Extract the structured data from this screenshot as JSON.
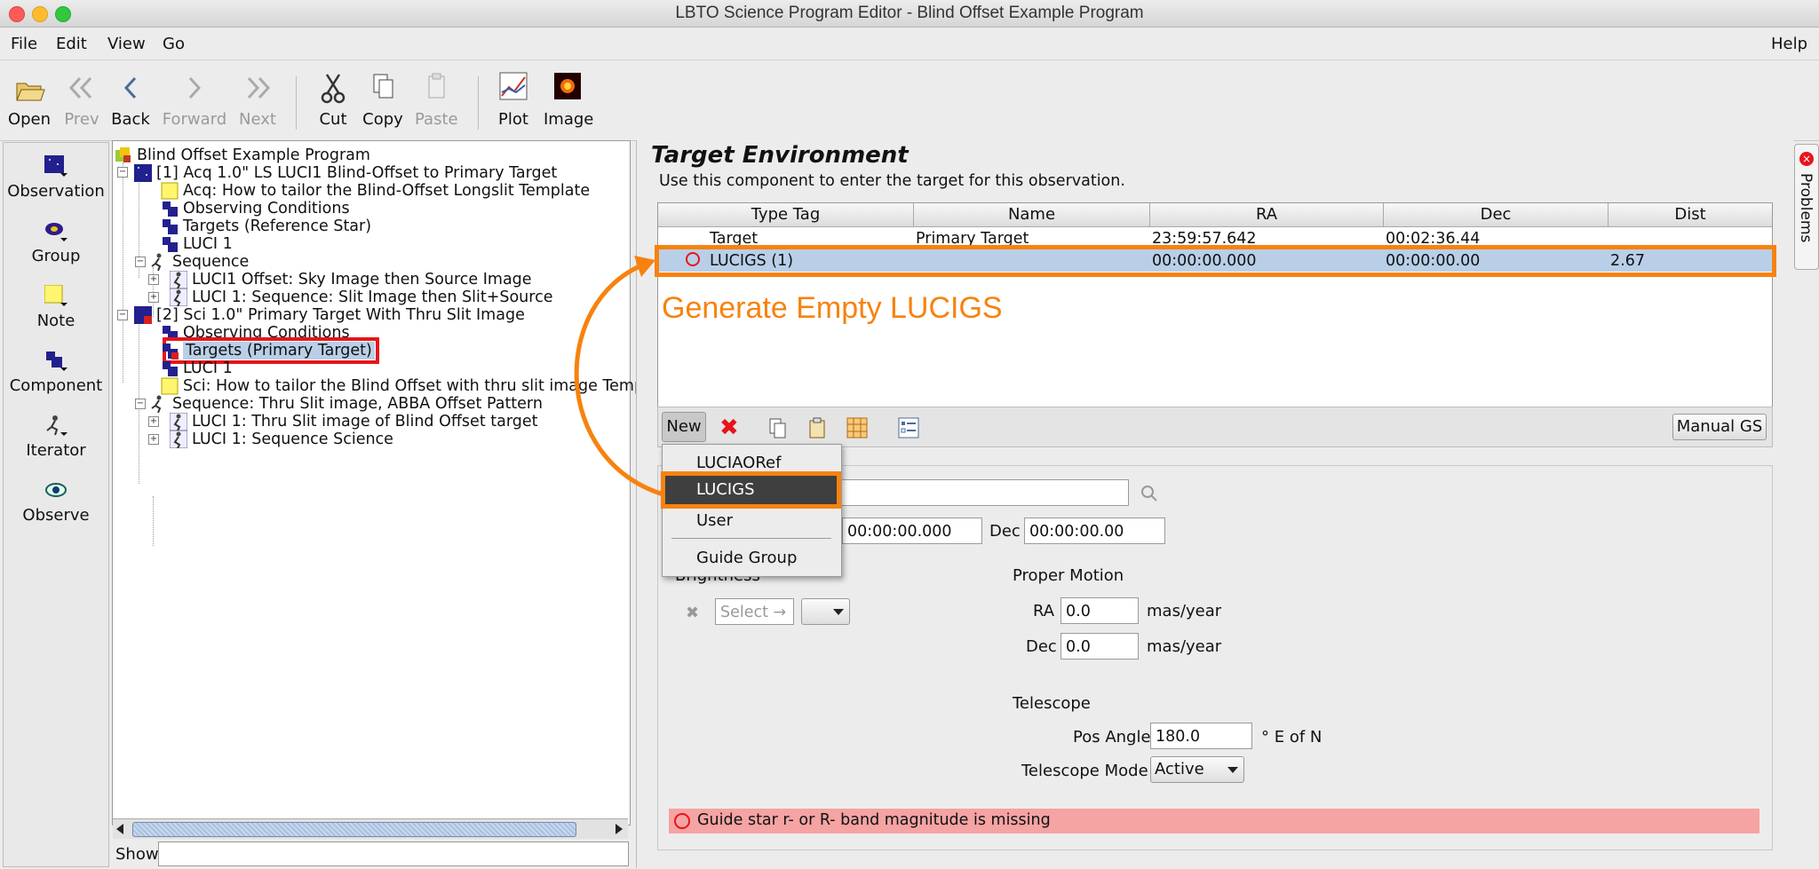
{
  "window": {
    "title": "LBTO Science Program Editor - Blind Offset Example Program"
  },
  "menu": {
    "file": "File",
    "edit": "Edit",
    "view": "View",
    "go": "Go",
    "help": "Help"
  },
  "toolbar": {
    "open": "Open",
    "prev": "Prev",
    "back": "Back",
    "forward": "Forward",
    "next": "Next",
    "cut": "Cut",
    "copy": "Copy",
    "paste": "Paste",
    "plot": "Plot",
    "image": "Image"
  },
  "palette": {
    "observation": "Observation",
    "group": "Group",
    "note": "Note",
    "component": "Component",
    "iterator": "Iterator",
    "observe": "Observe"
  },
  "tree": {
    "root": "Blind Offset Example Program",
    "nodes": [
      "[1] Acq 1.0\" LS LUCI1 Blind-Offset to Primary Target",
      "Acq: How to tailor the Blind-Offset Longslit Template",
      "Observing Conditions",
      "Targets (Reference Star)",
      "LUCI 1",
      "Sequence",
      "LUCI1 Offset: Sky Image then Source Image",
      "LUCI 1: Sequence: Slit Image then Slit+Source",
      "[2] Sci 1.0\" Primary Target With Thru Slit Image",
      "Observing Conditions",
      "Targets (Primary Target)",
      "LUCI 1",
      "Sci: How to tailor the Blind Offset with thru slit image Temp",
      "Sequence: Thru Slit image, ABBA Offset Pattern",
      "LUCI 1: Thru Slit image of Blind Offset target",
      "LUCI 1: Sequence Science"
    ],
    "show_label": "Show"
  },
  "target_env": {
    "title": "Target Environment",
    "description": "Use this component to enter the target for this observation.",
    "columns": [
      "Type Tag",
      "Name",
      "RA",
      "Dec",
      "Dist"
    ],
    "rows": [
      {
        "type": "Target",
        "name": "Primary Target",
        "ra": "23:59:57.642",
        "dec": "00:02:36.44",
        "dist": ""
      },
      {
        "type": "LUCIGS (1)",
        "name": "",
        "ra": "00:00:00.000",
        "dec": "00:00:00.00",
        "dist": "2.67"
      }
    ],
    "annotation": "Generate Empty LUCIGS",
    "new_button": "New",
    "manual_gs": "Manual GS",
    "new_menu": [
      "LUCIAORef",
      "LUCIGS",
      "User",
      "Guide Group"
    ]
  },
  "detail": {
    "ra_value": "00:00:00.000",
    "dec_label": "Dec",
    "dec_value": "00:00:00.00",
    "brightness_label": "Brightness",
    "select_placeholder": "Select →",
    "proper_motion_label": "Proper Motion",
    "pm_ra_label": "RA",
    "pm_ra_value": "0.0",
    "pm_dec_label": "Dec",
    "pm_dec_value": "0.0",
    "pm_unit": "mas/year",
    "telescope_label": "Telescope",
    "pos_angle_label": "Pos Angle",
    "pos_angle_value": "180.0",
    "pos_angle_unit": "° E of N",
    "telescope_mode_label": "Telescope Mode",
    "telescope_mode_value": "Active",
    "warning": "Guide star r- or R- band magnitude is missing"
  },
  "side_tab": {
    "problems": "Problems"
  },
  "colors": {
    "highlight_orange": "#f7820f",
    "selection_red": "#e8141a",
    "selection_blue": "#b9cfe8",
    "warning_bg": "#f5a3a3"
  }
}
